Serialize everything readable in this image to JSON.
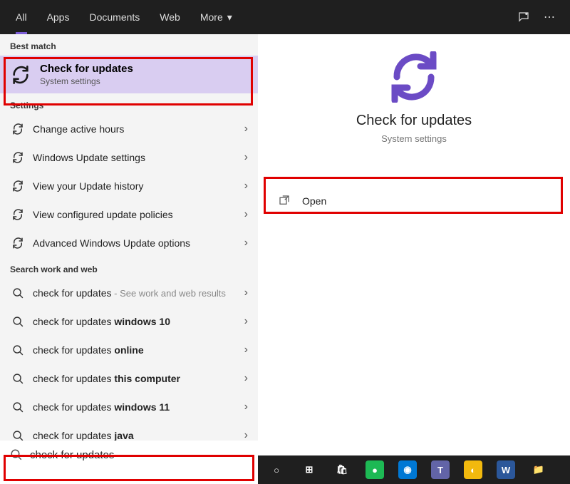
{
  "topbar": {
    "tabs": [
      {
        "label": "All",
        "active": true
      },
      {
        "label": "Apps"
      },
      {
        "label": "Documents"
      },
      {
        "label": "Web"
      },
      {
        "label": "More"
      }
    ]
  },
  "left": {
    "best_match_heading": "Best match",
    "best_match": {
      "title": "Check for updates",
      "subtitle": "System settings"
    },
    "settings_heading": "Settings",
    "settings": [
      {
        "label": "Change active hours"
      },
      {
        "label": "Windows Update settings"
      },
      {
        "label": "View your Update history"
      },
      {
        "label": "View configured update policies"
      },
      {
        "label": "Advanced Windows Update options"
      }
    ],
    "search_heading": "Search work and web",
    "web": [
      {
        "prefix": "check for updates",
        "bold": "",
        "hint": " - See work and web results"
      },
      {
        "prefix": "check for updates ",
        "bold": "windows 10"
      },
      {
        "prefix": "check for updates ",
        "bold": "online"
      },
      {
        "prefix": "check for updates ",
        "bold": "this computer"
      },
      {
        "prefix": "check for updates ",
        "bold": "windows 11"
      },
      {
        "prefix": "check for updates ",
        "bold": "java"
      }
    ]
  },
  "right": {
    "title": "Check for updates",
    "subtitle": "System settings",
    "action_label": "Open"
  },
  "search": {
    "value": "check for updates"
  },
  "taskbar": {
    "items": [
      {
        "name": "cortana-icon",
        "glyph": "○",
        "bg": "transparent"
      },
      {
        "name": "task-view-icon",
        "glyph": "⊞",
        "bg": "transparent"
      },
      {
        "name": "store-icon",
        "glyph": "🛍",
        "bg": "transparent"
      },
      {
        "name": "spotify-icon",
        "glyph": "●",
        "bg": "#1db954"
      },
      {
        "name": "edge-icon",
        "glyph": "◉",
        "bg": "#0078d4"
      },
      {
        "name": "teams-icon",
        "glyph": "T",
        "bg": "#6264a7"
      },
      {
        "name": "chrome-icon",
        "glyph": "◐",
        "bg": "#f2b90e"
      },
      {
        "name": "word-icon",
        "glyph": "W",
        "bg": "#2b579a"
      },
      {
        "name": "explorer-icon",
        "glyph": "📁",
        "bg": "transparent"
      }
    ]
  }
}
